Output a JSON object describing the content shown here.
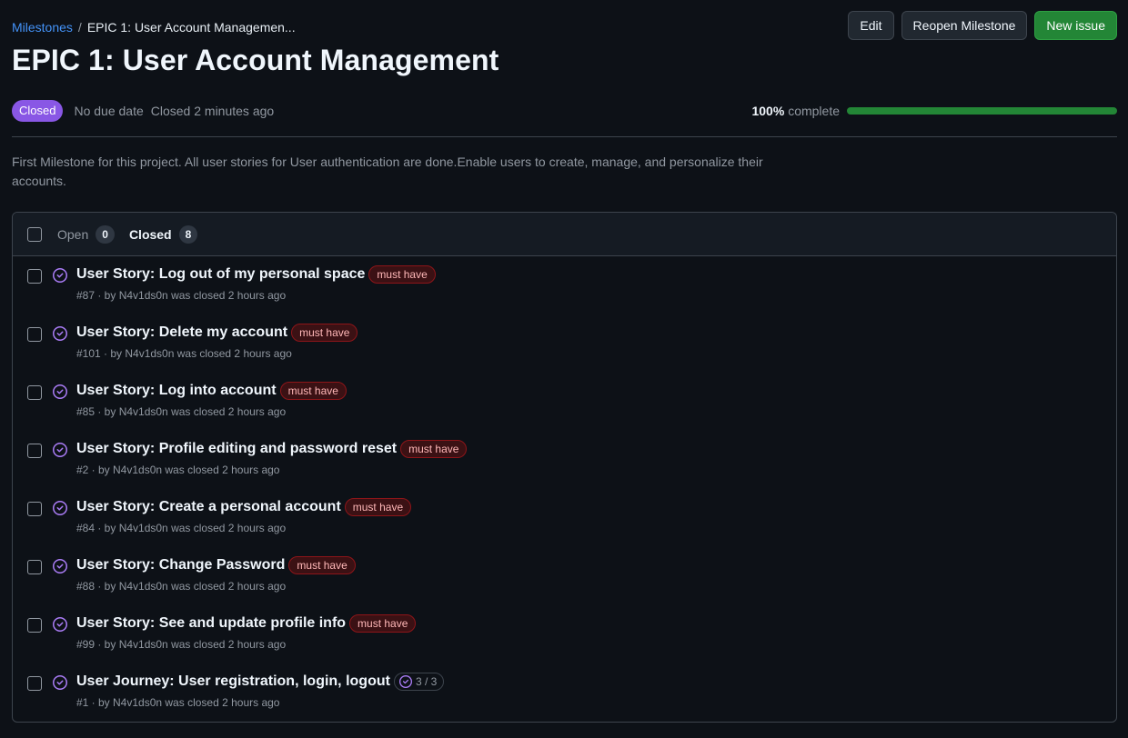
{
  "breadcrumb": {
    "parent": "Milestones",
    "separator": "/",
    "current": "EPIC 1: User Account Managemen..."
  },
  "title": "EPIC 1: User Account Management",
  "actions": {
    "edit": "Edit",
    "reopen": "Reopen Milestone",
    "new_issue": "New issue"
  },
  "meta": {
    "state": "Closed",
    "due": "No due date",
    "closed": "Closed 2 minutes ago"
  },
  "progress": {
    "percent_label": "100%",
    "suffix": "complete",
    "value": 1.0
  },
  "description": "First Milestone for this project. All user stories for User authentication are done.Enable users to create, manage, and personalize their accounts.",
  "tabs": {
    "open": {
      "label": "Open",
      "count": "0"
    },
    "closed": {
      "label": "Closed",
      "count": "8"
    }
  },
  "issues": [
    {
      "title": "User Story: Log out of my personal space",
      "label": "must have",
      "meta": "#87 · by N4v1ds0n was closed 2 hours ago"
    },
    {
      "title": "User Story: Delete my account",
      "label": "must have",
      "meta": "#101 · by N4v1ds0n was closed 2 hours ago"
    },
    {
      "title": "User Story: Log into account",
      "label": "must have",
      "meta": "#85 · by N4v1ds0n was closed 2 hours ago"
    },
    {
      "title": "User Story: Profile editing and password reset",
      "label": "must have",
      "meta": "#2 · by N4v1ds0n was closed 2 hours ago"
    },
    {
      "title": "User Story: Create a personal account",
      "label": "must have",
      "meta": "#84 · by N4v1ds0n was closed 2 hours ago"
    },
    {
      "title": "User Story: Change Password",
      "label": "must have",
      "meta": "#88 · by N4v1ds0n was closed 2 hours ago"
    },
    {
      "title": "User Story: See and update profile info",
      "label": "must have",
      "meta": "#99 · by N4v1ds0n was closed 2 hours ago"
    },
    {
      "title": "User Journey: User registration, login, logout",
      "tasks": "3 / 3",
      "meta": "#1 · by N4v1ds0n was closed 2 hours ago"
    }
  ],
  "colors": {
    "closed_purple": "#8957e5",
    "progress_green": "#238636",
    "label_red": "#8e1519"
  }
}
